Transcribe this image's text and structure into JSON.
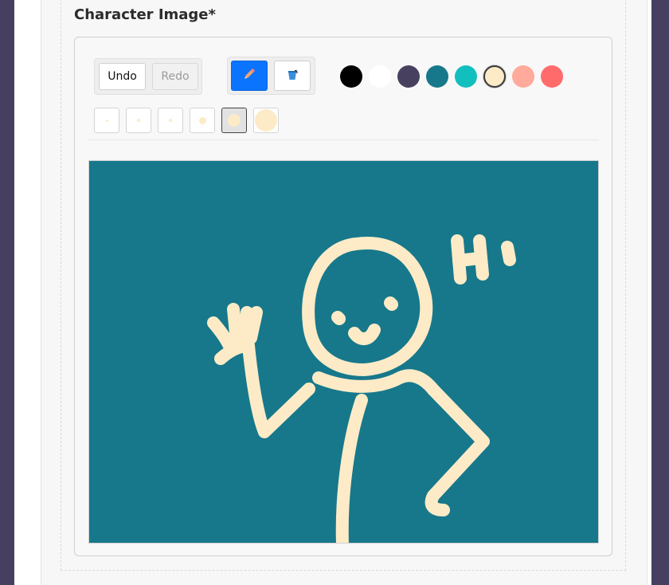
{
  "section": {
    "label": "Character Image*"
  },
  "history": {
    "undo_label": "Undo",
    "redo_label": "Redo"
  },
  "tools": {
    "pencil_icon": "pencil-icon",
    "bucket_icon": "paint-bucket-icon",
    "active_tool": "pencil"
  },
  "palette": {
    "colors": [
      "#000000",
      "#ffffff",
      "#47415f",
      "#17788b",
      "#12bfbf",
      "#fdebc7",
      "#ffaa9b",
      "#ff6b6b"
    ],
    "selected_color": "#fdebc7"
  },
  "brush_sizes": {
    "options": [
      "xs",
      "s",
      "m",
      "l",
      "xl",
      "xxl"
    ],
    "selected": "xl"
  },
  "drawing": {
    "background_color": "#17788b",
    "stroke_color": "#fdebc7",
    "text": "Hi"
  }
}
